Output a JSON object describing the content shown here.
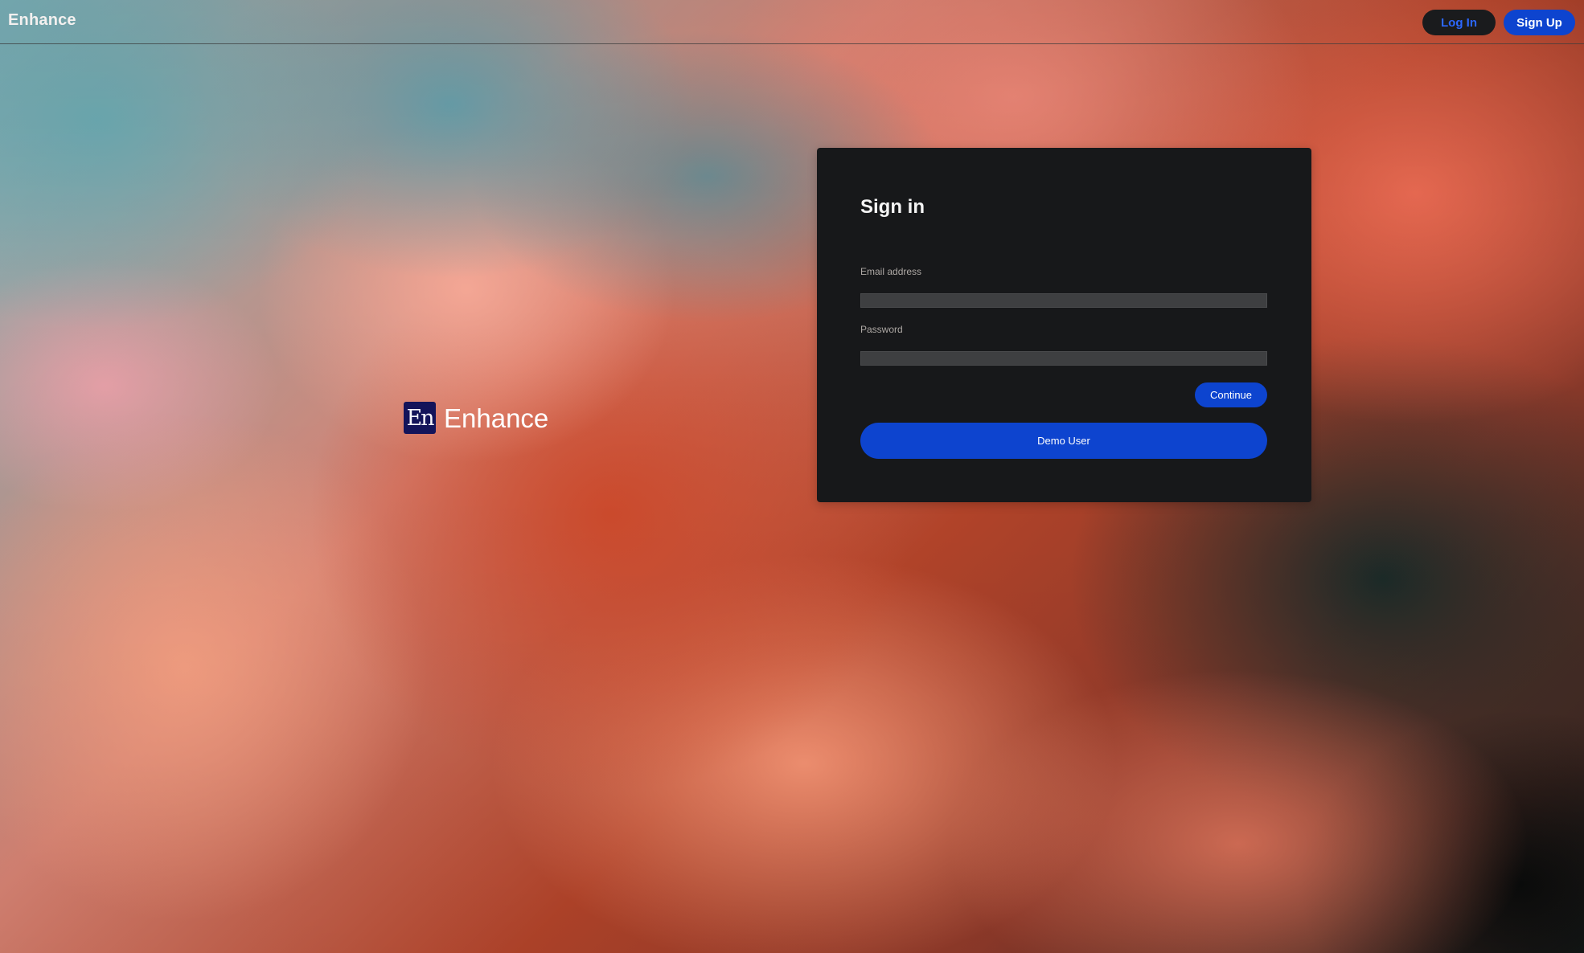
{
  "app": {
    "name": "Enhance",
    "logo_text": "En"
  },
  "header": {
    "title": "Enhance",
    "actions": {
      "login_label": "Log In",
      "signup_label": "Sign Up"
    }
  },
  "hero": {
    "brand_name": "Enhance",
    "logo_icon": "enhance-logo-icon"
  },
  "signin": {
    "title": "Sign in",
    "email": {
      "label": "Email address",
      "value": "",
      "placeholder": ""
    },
    "password": {
      "label": "Password",
      "value": "",
      "placeholder": ""
    },
    "continue_label": "Continue",
    "demo_label": "Demo User"
  },
  "colors": {
    "accent": "#0D44CF",
    "login_text": "#2C67FF",
    "panel": "#17181A",
    "field": "#3E3F41",
    "logo_background": "#13145A"
  }
}
